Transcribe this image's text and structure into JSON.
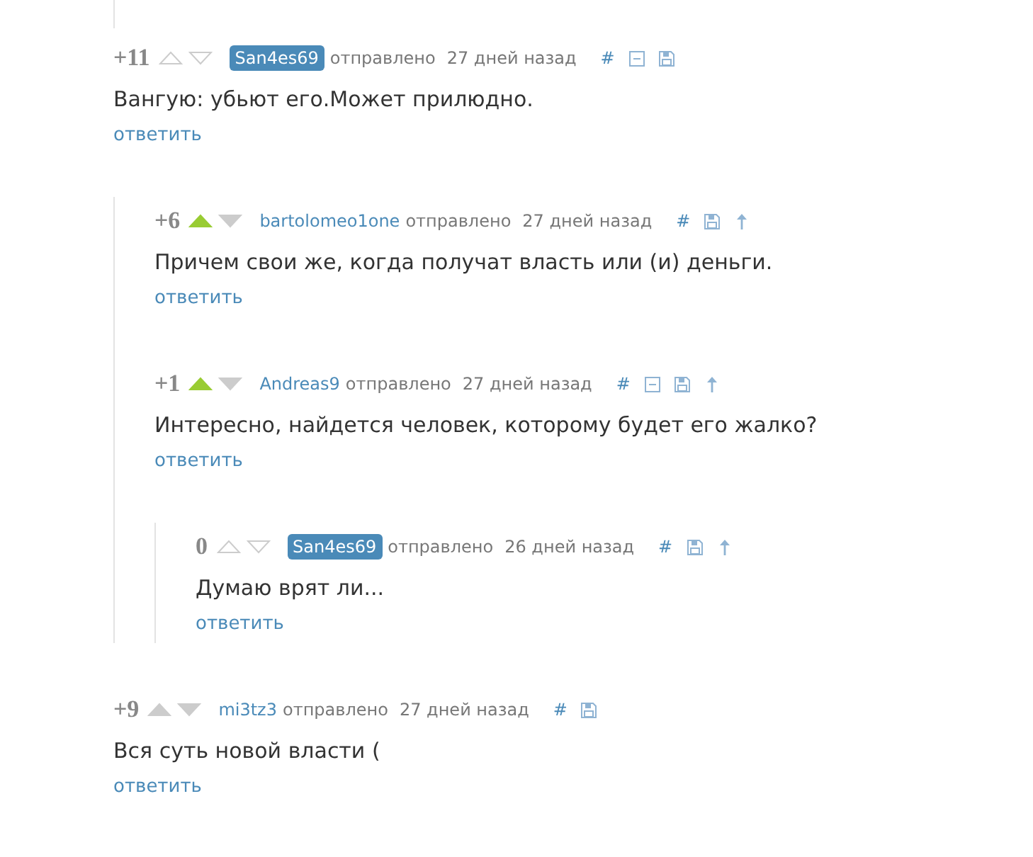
{
  "comments": [
    {
      "score": "+11",
      "vote_outline": true,
      "upvoted": false,
      "author": "San4es69",
      "author_badge": true,
      "sent": "отправлено",
      "age": "27 дней назад",
      "actions": [
        {
          "kind": "link",
          "label": "#"
        },
        {
          "kind": "collapse"
        },
        {
          "kind": "save"
        }
      ],
      "text": "Вангую: убьют его.Может прилюдно.",
      "reply": "ответить",
      "children": [
        {
          "score": "+6",
          "vote_outline": false,
          "upvoted": true,
          "author": "bartolomeo1one",
          "author_badge": false,
          "sent": "отправлено",
          "age": "27 дней назад",
          "actions": [
            {
              "kind": "link",
              "label": "#"
            },
            {
              "kind": "save"
            },
            {
              "kind": "parent"
            }
          ],
          "text": "Причем свои же, когда получат власть или (и) деньги.",
          "reply": "ответить"
        },
        {
          "score": "+1",
          "vote_outline": false,
          "upvoted": true,
          "author": "Andreas9",
          "author_badge": false,
          "sent": "отправлено",
          "age": "27 дней назад",
          "actions": [
            {
              "kind": "link",
              "label": "#"
            },
            {
              "kind": "collapse"
            },
            {
              "kind": "save"
            },
            {
              "kind": "parent"
            }
          ],
          "text": "Интересно, найдется человек, которому будет его жалко?",
          "reply": "ответить",
          "children": [
            {
              "score": "0",
              "vote_outline": true,
              "upvoted": false,
              "author": "San4es69",
              "author_badge": true,
              "sent": "отправлено",
              "age": "26 дней назад",
              "actions": [
                {
                  "kind": "link",
                  "label": "#"
                },
                {
                  "kind": "save"
                },
                {
                  "kind": "parent"
                }
              ],
              "text": "Думаю врят ли...",
              "reply": "ответить"
            }
          ]
        }
      ]
    },
    {
      "score": "+9",
      "vote_outline": false,
      "upvoted": false,
      "author": "mi3tz3",
      "author_badge": false,
      "sent": "отправлено",
      "age": "27 дней назад",
      "actions": [
        {
          "kind": "link",
          "label": "#"
        },
        {
          "kind": "save"
        }
      ],
      "text": "Вся суть новой власти (",
      "reply": "ответить"
    }
  ]
}
